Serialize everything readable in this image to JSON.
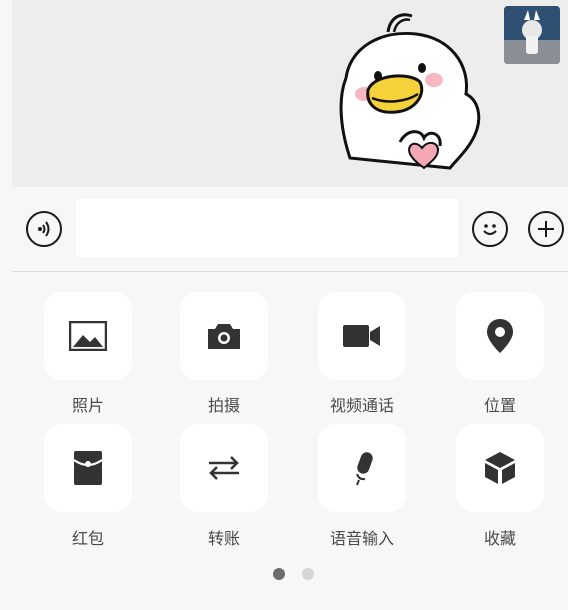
{
  "actions": [
    {
      "label": "照片",
      "icon": "photo-icon"
    },
    {
      "label": "拍摄",
      "icon": "camera-icon"
    },
    {
      "label": "视频通话",
      "icon": "video-call-icon"
    },
    {
      "label": "位置",
      "icon": "location-pin-icon"
    },
    {
      "label": "红包",
      "icon": "red-packet-icon"
    },
    {
      "label": "转账",
      "icon": "transfer-arrows-icon"
    },
    {
      "label": "语音输入",
      "icon": "microphone-icon"
    },
    {
      "label": "收藏",
      "icon": "favorites-box-icon"
    }
  ],
  "pager": {
    "current": 1,
    "total": 2
  },
  "colors": {
    "chat_bg": "#ededed",
    "panel_bg": "#f7f7f7",
    "icon": "#333333",
    "label": "#4a4a4a"
  }
}
